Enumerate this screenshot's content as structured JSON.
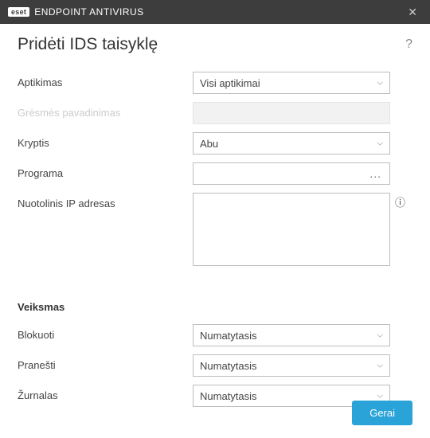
{
  "titlebar": {
    "brand_badge": "eset",
    "brand_text": "ENDPOINT ANTIVIRUS"
  },
  "heading": "Pridėti IDS taisyklę",
  "fields": {
    "detection": {
      "label": "Aptikimas",
      "value": "Visi aptikimai"
    },
    "threat_name": {
      "label": "Grėsmės pavadinimas"
    },
    "direction": {
      "label": "Kryptis",
      "value": "Abu"
    },
    "program": {
      "label": "Programa"
    },
    "remote_ip": {
      "label": "Nuotolinis IP adresas",
      "value": ""
    }
  },
  "action_section": {
    "heading": "Veiksmas",
    "block": {
      "label": "Blokuoti",
      "value": "Numatytasis"
    },
    "notify": {
      "label": "Pranešti",
      "value": "Numatytasis"
    },
    "log": {
      "label": "Žurnalas",
      "value": "Numatytasis"
    }
  },
  "footer": {
    "ok": "Gerai"
  }
}
